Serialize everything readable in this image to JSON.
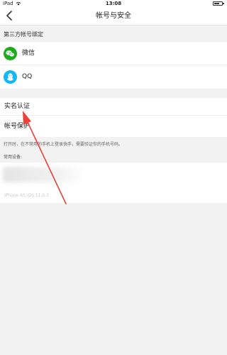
{
  "status_bar": {
    "carrier": "iPad",
    "time": "13:08"
  },
  "nav": {
    "title": "帐号与安全",
    "back_icon": "chevron-left-icon"
  },
  "third_party": {
    "header": "第三方帐号绑定",
    "accounts": [
      {
        "label": "微信",
        "icon": "wechat-icon",
        "color": "#1aad19"
      },
      {
        "label": "QQ",
        "icon": "qq-icon",
        "color": "#12b7f5"
      }
    ]
  },
  "real_name": {
    "label": "实名认证"
  },
  "protection": {
    "label": "帐号保护",
    "hint": "打开时，在不常用的手机上登录快手，需要验证你的手机号码。"
  },
  "devices": {
    "label": "常用设备:",
    "items": [
      {
        "model": "iPhone 6S iOS 11.0.3"
      }
    ]
  },
  "annotation": {
    "arrow_color": "#e8423a"
  }
}
